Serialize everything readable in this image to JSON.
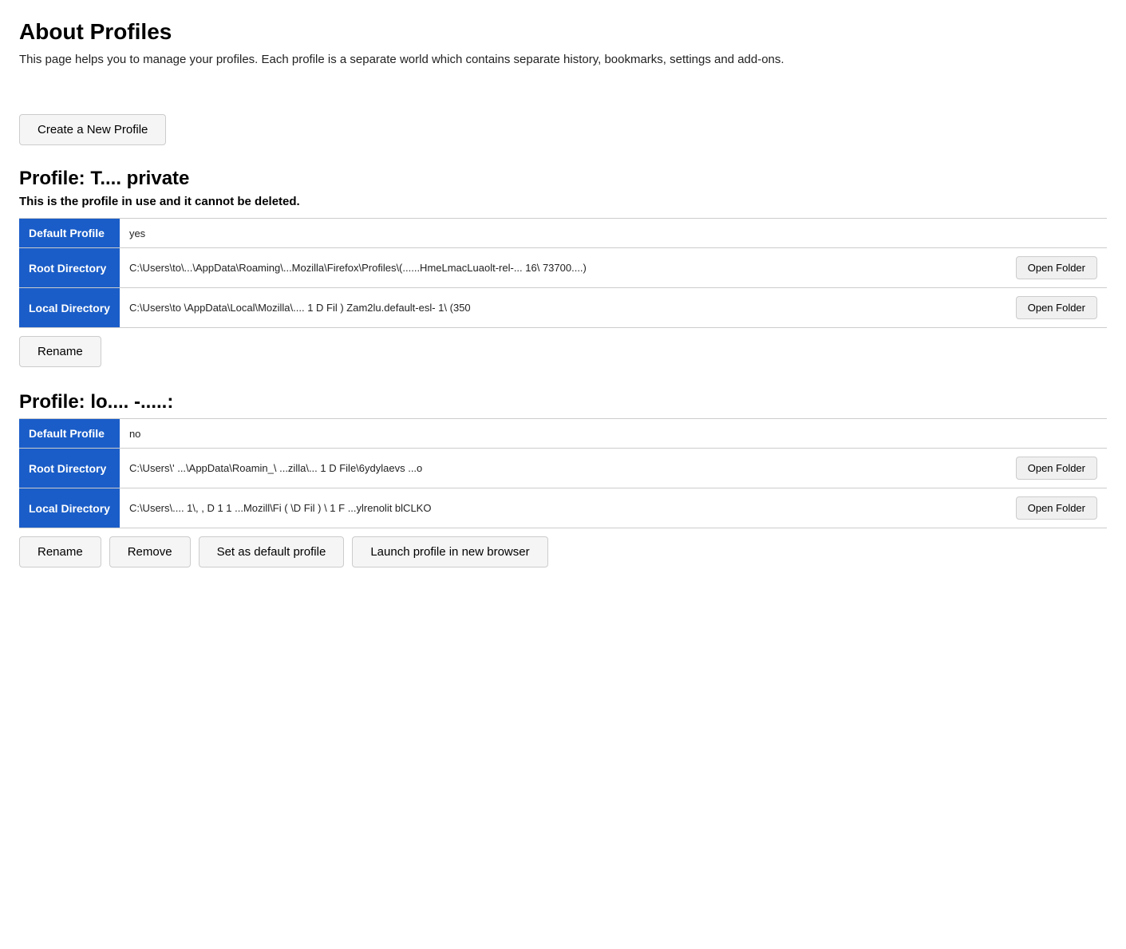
{
  "page": {
    "title": "About Profiles",
    "description": "This page helps you to manage your profiles. Each profile is a separate world which contains separate history, bookmarks, settings and add-ons."
  },
  "create_button": "Create a New Profile",
  "profile1": {
    "heading": "Profile: T.... private",
    "in_use_text": "This is the profile in use and it cannot be deleted.",
    "rows": [
      {
        "label": "Default Profile",
        "value": "yes",
        "has_button": false
      },
      {
        "label": "Root Directory",
        "value": "C:\\Users\\to\\...\\AppData\\Roaming\\...Mozilla\\Firefox\\Profiles\\(......HmeLmacLuaolt-rel-...   16\\   73700....) ",
        "has_button": true,
        "button_label": "Open Folder"
      },
      {
        "label": "Local Directory",
        "value": "C:\\Users\\to   \\AppData\\Local\\Mozilla\\....   1   D   Fil   )   Zam2lu.default-esl-  1\\   (350",
        "has_button": true,
        "button_label": "Open Folder"
      }
    ],
    "buttons": [
      "Rename"
    ]
  },
  "profile2": {
    "heading": "Profile: lo.... -.....:",
    "in_use_text": "",
    "rows": [
      {
        "label": "Default Profile",
        "value": "no",
        "has_button": false
      },
      {
        "label": "Root Directory",
        "value": "C:\\Users\\' ...\\AppData\\Roamin_\\   ...zilla\\...   1   D   File\\6ydylaevs           ...o",
        "has_button": true,
        "button_label": "Open Folder"
      },
      {
        "label": "Local Directory",
        "value": "C:\\Users\\....  1\\,  ,  D   1   1   ...Mozill\\Fi  (  \\D  Fil  )  \\  1   F   ...ylrenolit blCLKO",
        "has_button": true,
        "button_label": "Open Folder"
      }
    ],
    "buttons": [
      "Rename",
      "Remove",
      "Set as default profile",
      "Launch profile in new browser"
    ]
  }
}
